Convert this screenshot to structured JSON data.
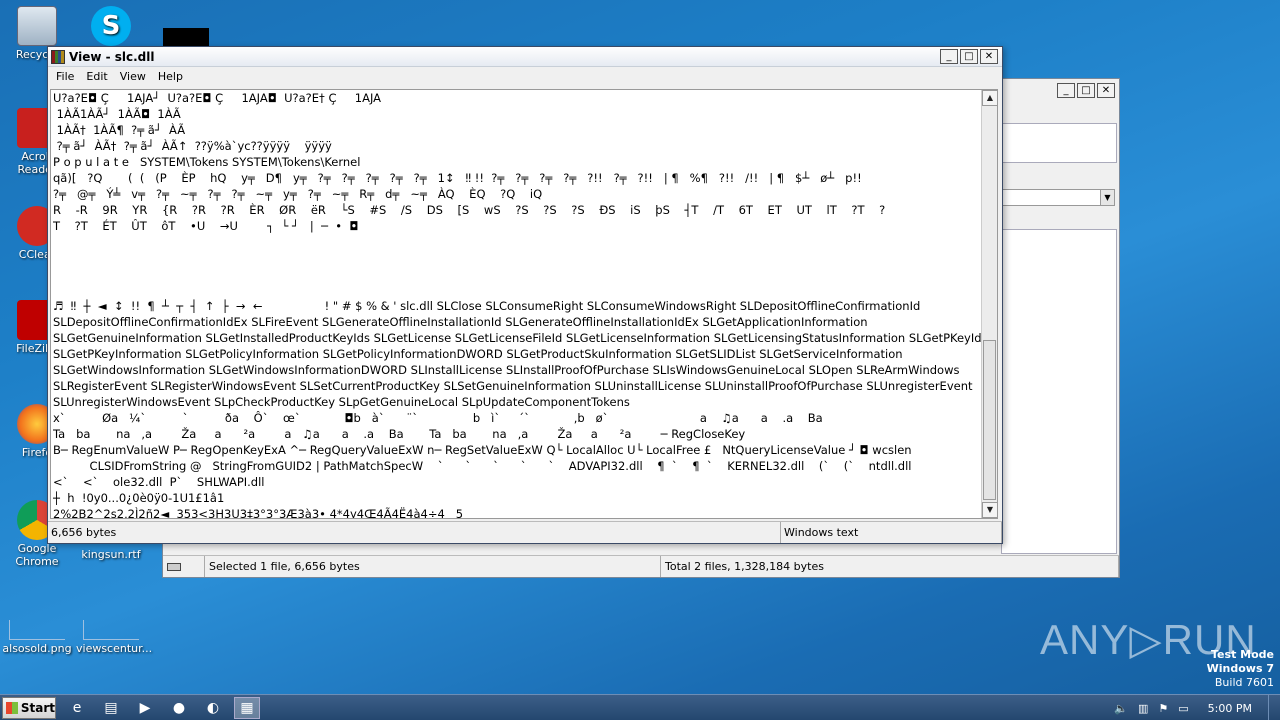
{
  "desktop": {
    "icons": [
      {
        "label": "Recycle"
      },
      {
        "label": "Acrob Reader"
      },
      {
        "label": "CClear"
      },
      {
        "label": "FileZilla"
      },
      {
        "label": "Firefo"
      },
      {
        "label": "Google Chrome"
      },
      {
        "label": "kingsun.rtf"
      },
      {
        "label": "alsosold.png"
      },
      {
        "label": "viewscentur..."
      }
    ]
  },
  "viewer": {
    "title": "View - slc.dll",
    "menu": [
      "File",
      "Edit",
      "View",
      "Help"
    ],
    "lines": [
      "U?a?E◘ Ç     1AJA┘  U?a?E◘ Ç     1AJA◘  U?a?E† Ç     1AJA",
      " 1ÀÃ1ÀÃ┘  1ÀÃ◘  1ÀÃ",
      " 1ÀÃ†  1ÀÃ¶  ?╤ ã┘  ÀÃ",
      " ?╤ ã┘  ÀÃ†  ?╤ ã┘  ÀÃ↑  ??ÿ%à`yc??ÿÿÿÿ    ÿÿÿÿ",
      "P o p u l a t e   SYSTEM\\Tokens SYSTEM\\Tokens\\Kernel",
      "qã)[   ?Q       (  (   (P    ÈP    hQ    y╤   D¶   y╤   ?╤   ?╤   ?╤   ?╤   ?╤   1↕   ‼ !!  ?╤   ?╤   ?╤   ?╤   ?!!   ?╤   ?!!   | ¶   %¶   ?!!   /!!   | ¶   $┴   ø┴   p!!",
      "?╤   @╤   Ý╧   v╤   ?╤   ~╤   ?╤   ?╤   ~╤   y╤   ?╤   ~╤   R╤   d╤   ~╤   ÀQ    ÈQ    ?Q    iQ",
      "R    -R    9R    YR    {R    ?R    ?R    ÈR    ØR    ëR    └S    #S    /S    DS    [S    wS    ?S    ?S    ?S    ÐS    iS    þS    ┤T    /T    6T    ET    UT    lT    ?T    ?",
      "T    ?T    ÉT    ÛT    ôT    •U    →U        ┐  └ ┘   |  ─  •  ◘",
      "",
      "",
      "",
      "",
      "♬  ‼  ┼  ◄  ↕  !!  ¶  ┴  ┬  ┤  ↑  ├  →  ←                 ! \" # $ % & ' slc.dll SLClose SLConsumeRight SLConsumeWindowsRight SLDepositOfflineConfirmationId",
      "SLDepositOfflineConfirmationIdEx SLFireEvent SLGenerateOfflineInstallationId SLGenerateOfflineInstallationIdEx SLGetApplicationInformation",
      "SLGetGenuineInformation SLGetInstalledProductKeyIds SLGetLicense SLGetLicenseFileId SLGetLicenseInformation SLGetLicensingStatusInformation SLGetPKeyId",
      "SLGetPKeyInformation SLGetPolicyInformation SLGetPolicyInformationDWORD SLGetProductSkuInformation SLGetSLIDList SLGetServiceInformation",
      "SLGetWindowsInformation SLGetWindowsInformationDWORD SLInstallLicense SLInstallProofOfPurchase SLIsWindowsGenuineLocal SLOpen SLReArmWindows",
      "SLRegisterEvent SLRegisterWindowsEvent SLSetCurrentProductKey SLSetGenuineInformation SLUninstallLicense SLUninstallProofOfPurchase SLUnregisterEvent",
      "SLUnregisterWindowsEvent SLpCheckProductKey SLpGetGenuineLocal SLpUpdateComponentTokens",
      "x`          Øa   ¼`          `          ða    Ô`    œ`            ◘b   à`      ¨`               b   ì`     ´`            ,b   ø`                         a    ♫a      a    .a    Ba",
      "Ta   ba       na   ,a        Ža     a      ²a        a   ♫a      a    .a    Ba       Ta   ba       na   ,a        Ža     a      ²a        ─ RegCloseKey",
      "B─ RegEnumValueW P─ RegOpenKeyExA ^─ RegQueryValueExW n─ RegSetValueExW Q└ LocalAlloc U└ LocalFree £   NtQueryLicenseValue ┘ ◘ wcslen",
      "          CLSIDFromString @   StringFromGUID2 | PathMatchSpecW    `      `      `      `      `    ADVAPI32.dll    ¶  `    ¶  `    KERNEL32.dll    (`    (`    ntdll.dll",
      "<`    <`    ole32.dll  P`    SHLWAPI.dll",
      "┼  h  !0y0...0¿0è0ÿ0-1U1£1â1",
      "2%2B2^2s2,2Ì2ñ2◄  353<3H3U3‡3°3°3Æ3à3• 4*4y4Œ4Ã4Ë4à4÷4   5",
      "5&5‡5'5£5È5Ô5   6%6/6®6"
    ],
    "status_size": "6,656 bytes",
    "status_encoding": "Windows text"
  },
  "back_window": {
    "status_selected": "Selected 1 file, 6,656 bytes",
    "status_total": "Total 2 files, 1,328,184 bytes"
  },
  "taskbar": {
    "start_label": "Start",
    "clock": "5:00 PM"
  },
  "watermark": "ANY▷RUN",
  "test_mode": {
    "line1": "Test Mode",
    "line2": "Windows 7",
    "line3": "Build 7601"
  }
}
